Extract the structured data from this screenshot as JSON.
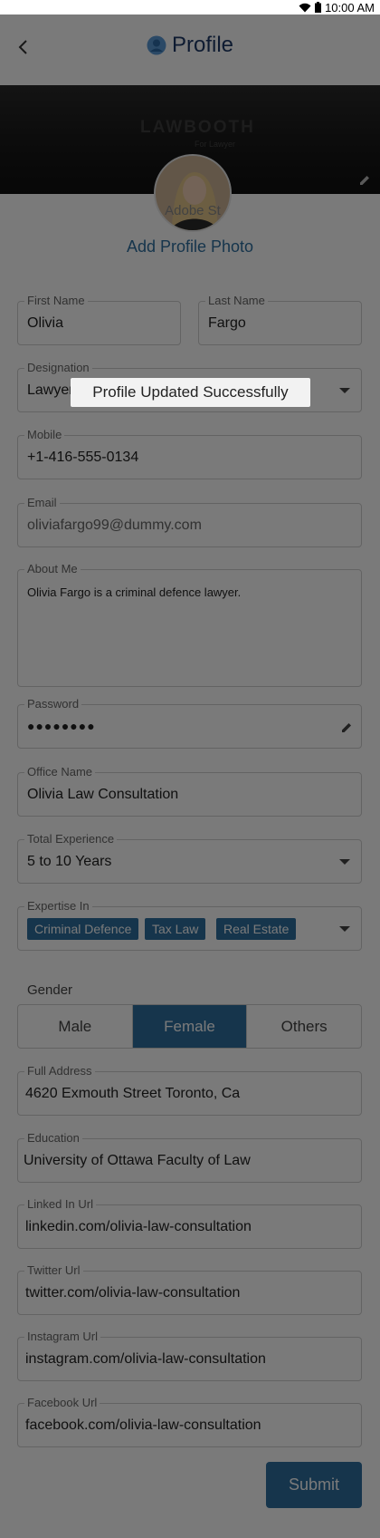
{
  "status_bar": {
    "time": "10:00 AM"
  },
  "header": {
    "title": "Profile",
    "back_icon": "back-chevron-icon",
    "title_icon": "user-avatar-icon"
  },
  "cover": {
    "logo_text": "LAWBOOTH",
    "logo_sub": "For Lawyer",
    "edit_icon": "pencil-icon"
  },
  "avatar": {
    "overlay_text": "Adobe St"
  },
  "add_photo_label": "Add Profile Photo",
  "fields": {
    "first_name": {
      "label": "First Name",
      "value": "Olivia"
    },
    "last_name": {
      "label": "Last Name",
      "value": "Fargo"
    },
    "designation": {
      "label": "Designation",
      "value": "Lawyer"
    },
    "mobile": {
      "label": "Mobile",
      "value": "+1-416-555-0134"
    },
    "email": {
      "label": "Email",
      "value": "oliviafargo99@dummy.com"
    },
    "about": {
      "label": "About Me",
      "value": "Olivia Fargo is a criminal defence lawyer."
    },
    "password": {
      "label": "Password",
      "value": "●●●●●●●●"
    },
    "office": {
      "label": "Office Name",
      "value": "Olivia Law Consultation"
    },
    "experience": {
      "label": "Total Experience",
      "value": "5 to 10 Years"
    },
    "expertise": {
      "label": "Expertise In",
      "chips": [
        "Criminal Defence",
        "Tax Law",
        "Real Estate"
      ]
    },
    "address": {
      "label": "Full Address",
      "value": "4620  Exmouth Street Toronto, Ca"
    },
    "education": {
      "label": "Education",
      "value": "University of Ottawa Faculty of Law"
    },
    "linkedin": {
      "label": "Linked In Url",
      "value": "linkedin.com/olivia-law-consultation"
    },
    "twitter": {
      "label": "Twitter Url",
      "value": "twitter.com/olivia-law-consultation"
    },
    "instagram": {
      "label": "Instagram Url",
      "value": "instagram.com/olivia-law-consultation"
    },
    "facebook": {
      "label": "Facebook Url",
      "value": "facebook.com/olivia-law-consultation"
    }
  },
  "gender": {
    "label": "Gender",
    "options": [
      "Male",
      "Female",
      "Others"
    ],
    "selected": "Female"
  },
  "submit_label": "Submit",
  "toast": "Profile Updated Successfully",
  "colors": {
    "accent": "#2e6fa0",
    "title": "#1f3a66",
    "overlay": "rgba(0,0,0,0.52)"
  }
}
